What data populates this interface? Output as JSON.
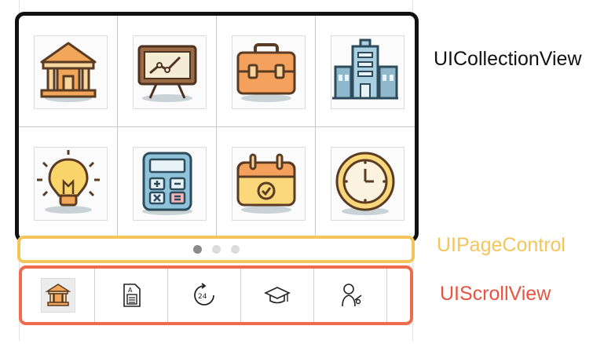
{
  "labels": {
    "collection_view": "UICollectionView",
    "page_control": "UIPageControl",
    "scroll_view": "UIScrollView"
  },
  "colors": {
    "collection_border": "#111111",
    "page_control_border": "#f3c55a",
    "page_control_label": "#f3c55a",
    "scroll_view_border": "#ee6c4d",
    "scroll_view_label": "#e8533f"
  },
  "collection_view": {
    "icons": [
      "bank-icon",
      "presentation-board-icon",
      "briefcase-icon",
      "city-buildings-icon",
      "lightbulb-icon",
      "calculator-icon",
      "calendar-check-icon",
      "clock-icon"
    ]
  },
  "page_control": {
    "page_count": 3,
    "current_page": 1
  },
  "scroll_view": {
    "icons": [
      "bank-icon",
      "document-grade-icon",
      "24-hours-icon",
      "graduation-cap-icon",
      "student-icon"
    ],
    "selected_index": 0
  }
}
